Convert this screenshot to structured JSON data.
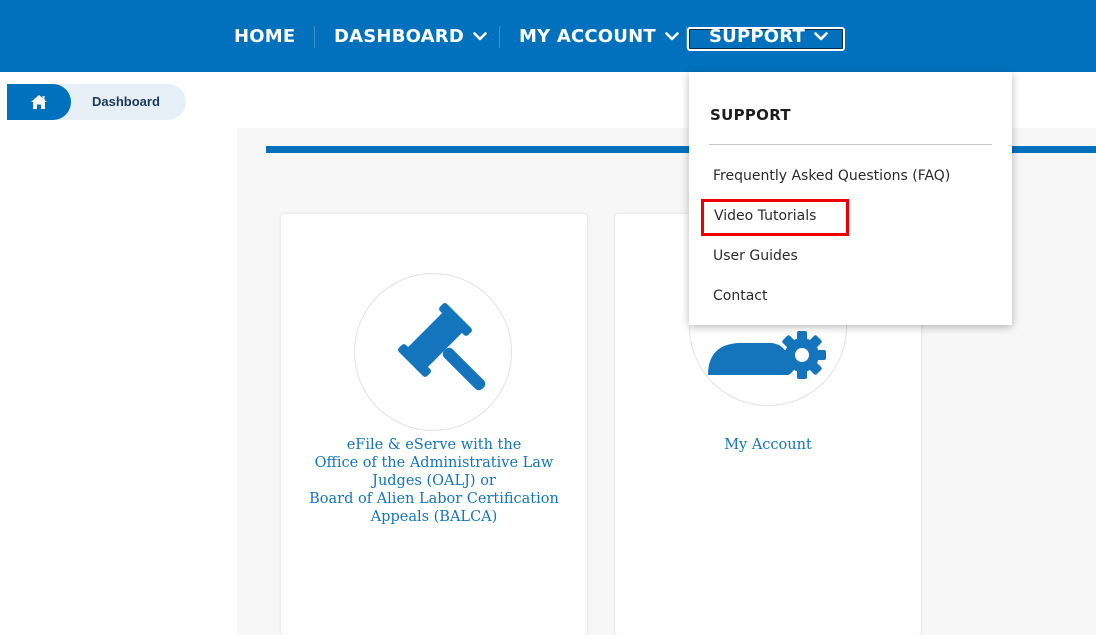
{
  "nav": {
    "home": "HOME",
    "dashboard": "DASHBOARD",
    "my_account": "MY ACCOUNT",
    "support": "SUPPORT"
  },
  "breadcrumb": {
    "current": "Dashboard",
    "home_icon": "home-icon"
  },
  "cards": [
    {
      "icon": "gavel-icon",
      "lines": [
        "eFile & eServe with the",
        "Office of the Administrative Law",
        "Judges (OALJ) or",
        "Board of Alien Labor Certification",
        "Appeals (BALCA)"
      ]
    },
    {
      "icon": "user-gear-icon",
      "lines": [
        "My Account"
      ]
    }
  ],
  "support_menu": {
    "heading": "SUPPORT",
    "items": [
      "Frequently Asked Questions (FAQ)",
      "Video Tutorials",
      "User Guides",
      "Contact"
    ],
    "highlighted": "Video Tutorials"
  },
  "colors": {
    "brand_blue": "#0171bd",
    "highlight_red": "#ee0000"
  }
}
